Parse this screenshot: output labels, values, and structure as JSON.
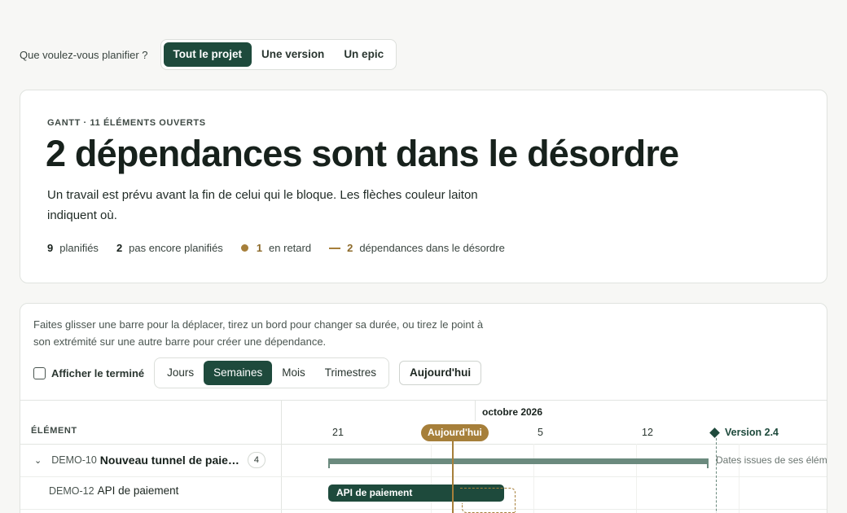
{
  "scope": {
    "question": "Que voulez-vous planifier ?",
    "options": [
      "Tout le projet",
      "Une version",
      "Un epic"
    ],
    "selected": "Tout le projet"
  },
  "summary": {
    "eyebrow": "GANTT · 11 ÉLÉMENTS OUVERTS",
    "headline": "2 dépendances sont dans le désordre",
    "lede": "Un travail est prévu avant la fin de celui qui le bloque. Les flèches couleur laiton indiquent où.",
    "stats": [
      {
        "value": "9",
        "label": "planifiés"
      },
      {
        "value": "2",
        "label": "pas encore planifiés"
      },
      {
        "value": "1",
        "label": "en retard",
        "marker": "dot"
      },
      {
        "value": "2",
        "label": "dépendances dans le désordre",
        "marker": "dash"
      }
    ]
  },
  "gantt": {
    "hint": "Faites glisser une barre pour la déplacer, tirez un bord pour changer sa durée, ou tirez le point à son extrémité sur une autre barre pour créer une dépendance.",
    "show_done_label": "Afficher le terminé",
    "zoom_options": [
      "Jours",
      "Semaines",
      "Mois",
      "Trimestres"
    ],
    "zoom_selected": "Semaines",
    "today_button": "Aujourd'hui",
    "column_header": "ÉLÉMENT",
    "month": "octobre 2026",
    "weeks": [
      "21",
      "5",
      "12"
    ],
    "today_marker": "Aujourd'hui",
    "version_marker": "Version 2.4",
    "rows": [
      {
        "key": "DEMO-10",
        "title": "Nouveau tunnel de paie…",
        "count": "4",
        "note": "Dates issues de ses élém"
      },
      {
        "key": "DEMO-12",
        "title": "API de paiement",
        "bar_label": "API de paiement"
      }
    ]
  },
  "colors": {
    "accent": "#1e4a3c",
    "brass": "#a67f3a",
    "epic": "#6b8a7e"
  }
}
